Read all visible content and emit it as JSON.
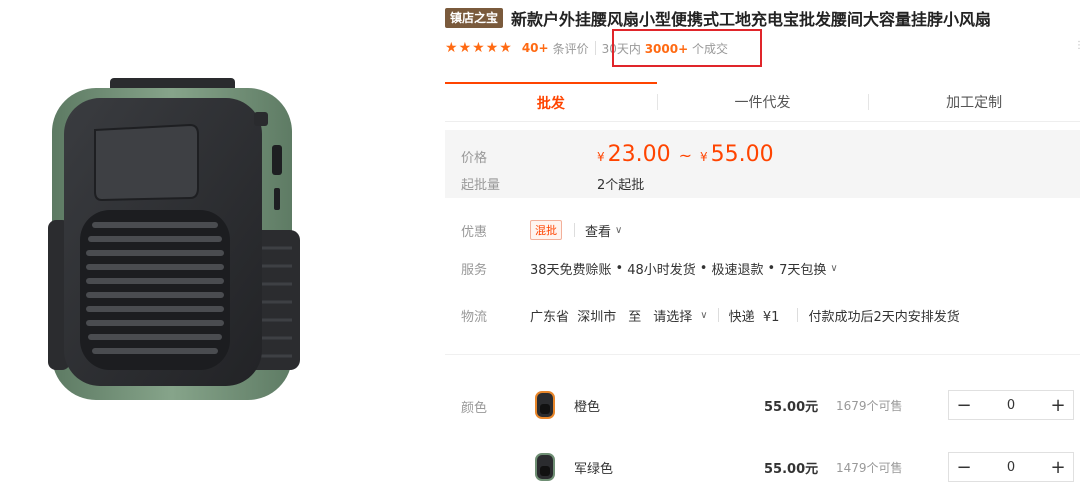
{
  "product": {
    "badge": "镇店之宝",
    "title": "新款户外挂腰风扇小型便携式工地充电宝批发腰间大容量挂脖小风扇"
  },
  "rating": {
    "stars": 5,
    "review_count": "40+",
    "review_label": "条评价",
    "deal_prefix": "30天内",
    "deal_count": "3000+",
    "deal_suffix": "个成交"
  },
  "tabs": [
    {
      "label": "批发",
      "active": true
    },
    {
      "label": "一件代发",
      "active": false
    },
    {
      "label": "加工定制",
      "active": false
    }
  ],
  "price": {
    "label": "价格",
    "currency": "¥",
    "min": "23.00",
    "max": "55.00",
    "moq_label": "起批量",
    "moq_value": "2个起批"
  },
  "promo": {
    "label": "优惠",
    "tag": "混批",
    "link": "查看"
  },
  "service": {
    "label": "服务",
    "items": [
      "38天免费赊账",
      "48小时发货",
      "极速退款",
      "7天包换"
    ]
  },
  "logistics": {
    "label": "物流",
    "from": "广东省  深圳市",
    "to_label": "至",
    "to_select": "请选择",
    "shipping": "快递  ¥1",
    "promise": "付款成功后2天内安排发货"
  },
  "variants_label": "颜色",
  "variants": [
    {
      "name": "橙色",
      "price": "55.00元",
      "stock": "1679个可售",
      "qty": "0",
      "accent": "#e8862a"
    },
    {
      "name": "军绿色",
      "price": "55.00元",
      "stock": "1479个可售",
      "qty": "0",
      "accent": "#6f8f74"
    }
  ],
  "colors": {
    "accent": "#ff4400",
    "highlight_box": "#e0252a",
    "badge": "#7a5a3c"
  }
}
